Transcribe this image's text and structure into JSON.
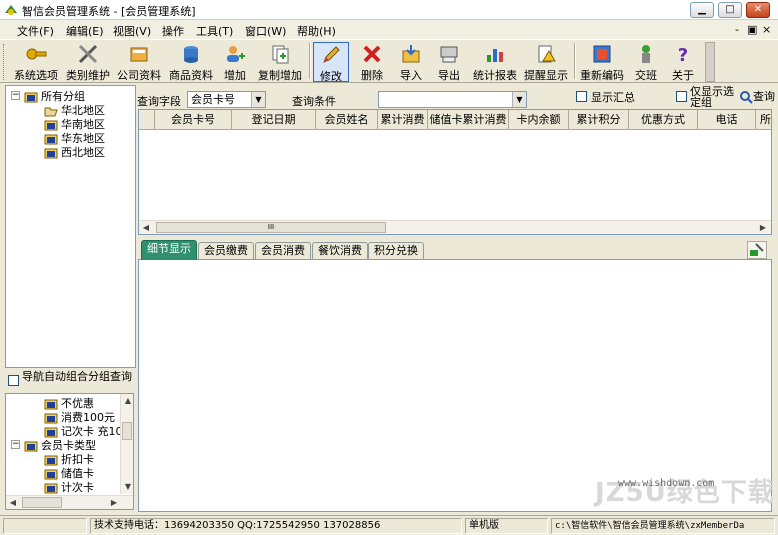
{
  "window": {
    "title": "智信会员管理系统 - [会员管理系统]",
    "controls": {
      "minimize": "▁",
      "maximize": "□",
      "close": "✕"
    }
  },
  "menu": {
    "items": [
      "文件(F)",
      "编辑(E)",
      "视图(V)",
      "操作",
      "工具(T)",
      "窗口(W)",
      "帮助(H)"
    ],
    "mdi_controls": {
      "minimize": "-",
      "restore": "▣",
      "close": "×"
    }
  },
  "toolbar": {
    "buttons": [
      {
        "label": "系统选项",
        "icon": "key-icon"
      },
      {
        "label": "类别维护",
        "icon": "tools-icon"
      },
      {
        "label": "公司资料",
        "icon": "notebook-icon"
      },
      {
        "label": "商品资料",
        "icon": "database-icon"
      },
      {
        "label": "增加",
        "icon": "add-user-icon"
      },
      {
        "label": "复制增加",
        "icon": "copy-add-icon"
      },
      {
        "label": "修改",
        "icon": "pencil-icon"
      },
      {
        "label": "删除",
        "icon": "delete-icon"
      },
      {
        "label": "导入",
        "icon": "import-icon"
      },
      {
        "label": "导出",
        "icon": "export-icon"
      },
      {
        "label": "统计报表",
        "icon": "chart-icon"
      },
      {
        "label": "提醒显示",
        "icon": "alert-icon"
      },
      {
        "label": "重新编码",
        "icon": "recode-icon"
      },
      {
        "label": "交班",
        "icon": "shift-icon"
      },
      {
        "label": "关于",
        "icon": "help-icon"
      }
    ],
    "active": "修改"
  },
  "group_tree": {
    "root": "所有分组",
    "children": [
      "华北地区",
      "华南地区",
      "华东地区",
      "西北地区"
    ],
    "selected": "华北地区"
  },
  "nav_checkbox": {
    "label": "导航自动组合分组查询",
    "checked": false
  },
  "card_tree": {
    "items": [
      {
        "label": "不优惠",
        "level": 1
      },
      {
        "label": "消费100元 ",
        "level": 1
      },
      {
        "label": "记次卡 充10",
        "level": 1
      },
      {
        "label": "会员卡类型",
        "level": 0
      },
      {
        "label": "折扣卡",
        "level": 1
      },
      {
        "label": "储值卡",
        "level": 1
      },
      {
        "label": "计次卡",
        "level": 1
      }
    ]
  },
  "query": {
    "field_label": "查询字段",
    "field_value": "会员卡号",
    "condition_label": "查询条件",
    "condition_value": "",
    "show_summary": "显示汇总",
    "show_selected_only": "仅显示选定组",
    "search_button": "查询"
  },
  "grid": {
    "columns": [
      "会员卡号",
      "登记日期",
      "会员姓名",
      "累计消费",
      "储值卡累计消费",
      "卡内余额",
      "累计积分",
      "优惠方式",
      "电话",
      "所"
    ],
    "rows": []
  },
  "tabs": {
    "items": [
      "细节显示",
      "会员缴费",
      "会员消费",
      "餐饮消费",
      "积分兑换"
    ],
    "active": "细节显示"
  },
  "watermark": {
    "text": "JZ5U绿色下载",
    "url": "www.wishdown.com"
  },
  "statusbar": {
    "support": "技术支持电话：13694203350 QQ:1725542950 137028856",
    "mode": "单机版",
    "path": "c:\\智信软件\\智信会员管理系统\\zxMemberDa"
  },
  "colors": {
    "active_tab": "#2f8f6e",
    "chrome": "#ece9d8",
    "border": "#7f9db9"
  }
}
